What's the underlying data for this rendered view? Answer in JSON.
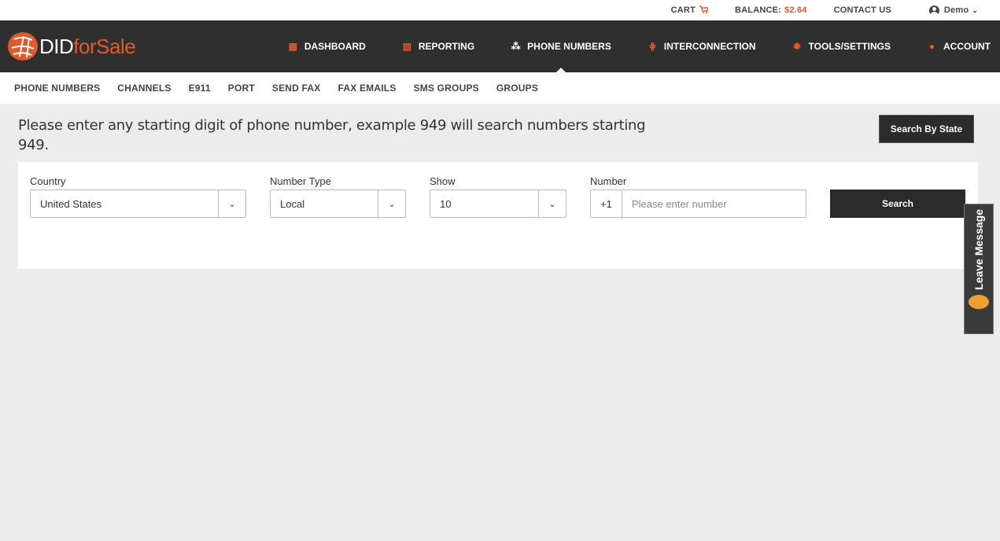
{
  "topbar": {
    "cart_label": "CART",
    "balance_label": "BALANCE:",
    "balance_value": "$2.64",
    "contact_label": "CONTACT US",
    "user_name": "Demo"
  },
  "brand": {
    "name_part1": "DID",
    "name_part2": "for",
    "name_part3": "Sale",
    "accent_color": "#e05a2b"
  },
  "mainnav": {
    "items": [
      {
        "label": "DASHBOARD",
        "icon": "dashboard-icon"
      },
      {
        "label": "REPORTING",
        "icon": "chart-icon"
      },
      {
        "label": "PHONE NUMBERS",
        "icon": "phone-icon",
        "active": true
      },
      {
        "label": "INTERCONNECTION",
        "icon": "sliders-icon"
      },
      {
        "label": "TOOLS/SETTINGS",
        "icon": "gear-icon"
      },
      {
        "label": "ACCOUNT",
        "icon": "user-icon"
      }
    ]
  },
  "subnav": {
    "items": [
      "PHONE NUMBERS",
      "CHANNELS",
      "E911",
      "PORT",
      "SEND FAX",
      "FAX EMAILS",
      "SMS GROUPS",
      "GROUPS"
    ]
  },
  "main": {
    "instruction": "Please enter any starting digit of phone number, example 949 will search numbers starting 949.",
    "search_by_state_label": "Search By State",
    "form": {
      "country_label": "Country",
      "country_value": "United States",
      "number_type_label": "Number Type",
      "number_type_value": "Local",
      "show_label": "Show",
      "show_value": "10",
      "number_label": "Number",
      "number_prefix": "+1",
      "number_placeholder": "Please enter number",
      "search_label": "Search"
    }
  },
  "widget": {
    "leave_message_label": "Leave Message"
  }
}
